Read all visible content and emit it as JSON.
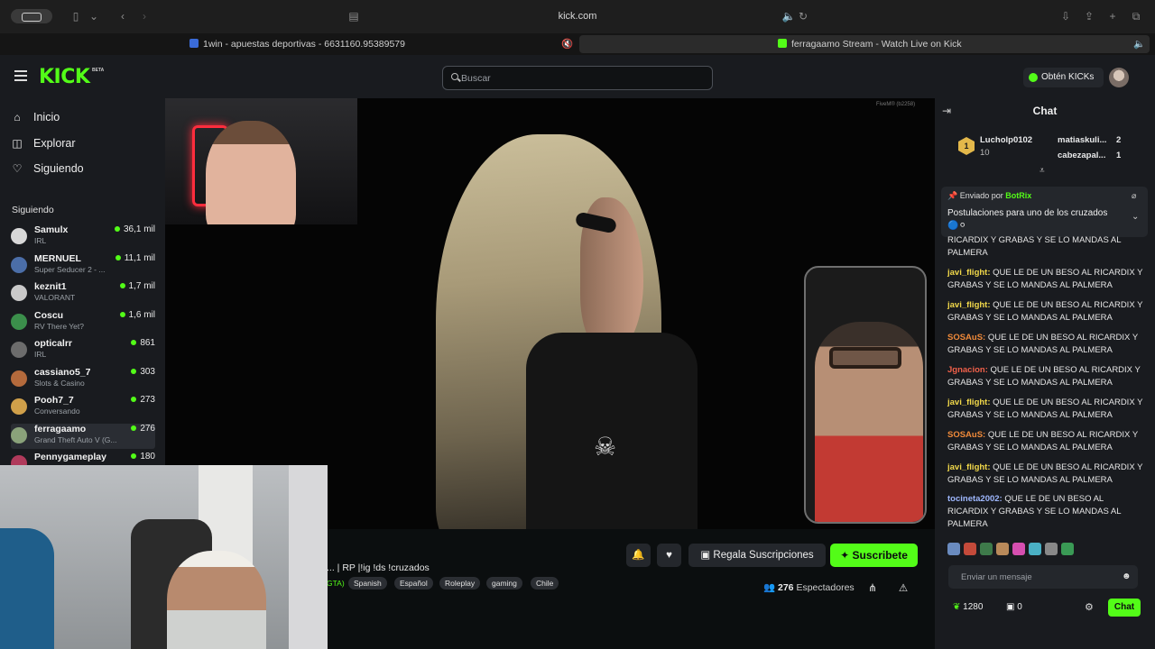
{
  "browser": {
    "url": "kick.com",
    "tabs": [
      {
        "label": "1win - apuestas deportivas - 6631160.95389579"
      },
      {
        "label": "ferragaamo Stream - Watch Live on Kick"
      }
    ]
  },
  "header": {
    "logo": "KICK",
    "beta": "BETA",
    "search_placeholder": "Buscar",
    "kicks_label": "Obtén KICKs"
  },
  "sidebar": {
    "nav": [
      {
        "label": "Inicio",
        "icon": "home-icon"
      },
      {
        "label": "Explorar",
        "icon": "compass-icon"
      },
      {
        "label": "Siguiendo",
        "icon": "heart-icon"
      }
    ],
    "section_title": "Siguiendo",
    "following": [
      {
        "name": "Samulx",
        "category": "IRL",
        "viewers": "36,1 mil",
        "color": "#d8d8d8"
      },
      {
        "name": "MERNUEL",
        "category": "Super Seducer 2 - ...",
        "viewers": "11,1 mil",
        "color": "#4b6ea8"
      },
      {
        "name": "keznit1",
        "category": "VALORANT",
        "viewers": "1,7 mil",
        "color": "#c9c9c9"
      },
      {
        "name": "Coscu",
        "category": "RV There Yet?",
        "viewers": "1,6 mil",
        "color": "#3b8f4b"
      },
      {
        "name": "opticalrr",
        "category": "IRL",
        "viewers": "861",
        "color": "#6c6c6c"
      },
      {
        "name": "cassiano5_7",
        "category": "Slots & Casino",
        "viewers": "303",
        "color": "#b46a3c"
      },
      {
        "name": "Pooh7_7",
        "category": "Conversando",
        "viewers": "273",
        "color": "#d0a04a"
      },
      {
        "name": "ferragaamo",
        "category": "Grand Theft Auto V (G...",
        "viewers": "276",
        "color": "#8aa27a"
      },
      {
        "name": "Pennygameplay",
        "category": "",
        "viewers": "180",
        "color": "#b03a5b"
      }
    ]
  },
  "stream": {
    "title": "... | RP |!ig !ds !cruzados",
    "tag_fragment": "GTA)",
    "tags": [
      "Spanish",
      "Español",
      "Roleplay",
      "gaming",
      "Chile"
    ],
    "gift_label": "Regala Suscripciones",
    "subscribe_label": "Suscribete",
    "viewers_count": "276",
    "viewers_label": "Espectadores",
    "watermark": "FiveM® (b2258)"
  },
  "chat": {
    "title": "Chat",
    "leaderboard": [
      {
        "name": "Lucholp0102",
        "count": "10",
        "color": "#e3b84a"
      },
      {
        "name": "matiaskuli...",
        "count": "2",
        "color": "#e8e8e8"
      },
      {
        "name": "cabezapal...",
        "count": "1",
        "color": "#e3b84a"
      }
    ],
    "pinned_by": "Enviado por",
    "pinned_user": "BotRix",
    "pinned_text": "Postulaciones para uno de los cruzados 🔵⚪",
    "messages": [
      {
        "user": "",
        "text": "RICARDIX Y GRABAS Y SE LO MANDAS AL PALMERA",
        "color": "#e6e6e6"
      },
      {
        "user": "javi_flight:",
        "text": "QUE LE DE UN BESO AL RICARDIX Y GRABAS Y SE LO MANDAS AL PALMERA",
        "color": "#f2d94a"
      },
      {
        "user": "javi_flight:",
        "text": "QUE LE DE UN BESO AL RICARDIX Y GRABAS Y SE LO MANDAS AL PALMERA",
        "color": "#f2d94a"
      },
      {
        "user": "SOSAuS:",
        "text": "QUE LE DE UN BESO AL RICARDIX Y GRABAS Y SE LO MANDAS AL PALMERA",
        "color": "#f08a3a"
      },
      {
        "user": "Jgnacion:",
        "text": "QUE LE DE UN BESO AL RICARDIX Y GRABAS Y SE LO MANDAS AL PALMERA",
        "color": "#f0604a"
      },
      {
        "user": "javi_flight:",
        "text": "QUE LE DE UN BESO AL RICARDIX Y GRABAS Y SE LO MANDAS AL PALMERA",
        "color": "#f2d94a"
      },
      {
        "user": "SOSAuS:",
        "text": "QUE LE DE UN BESO AL RICARDIX Y GRABAS Y SE LO MANDAS AL PALMERA",
        "color": "#f08a3a"
      },
      {
        "user": "javi_flight:",
        "text": "QUE LE DE UN BESO AL RICARDIX Y GRABAS Y SE LO MANDAS AL PALMERA",
        "color": "#f2d94a"
      },
      {
        "user": "tocineta2002:",
        "text": "QUE LE DE UN BESO AL RICARDIX Y GRABAS Y SE LO MANDAS AL PALMERA",
        "color": "#9fb8ff"
      }
    ],
    "input_placeholder": "Enviar un mensaje",
    "points": "1280",
    "gifts": "0",
    "send_label": "Chat"
  },
  "colors": {
    "brand": "#53fc18",
    "bg": "#0b0e0f",
    "panel": "#191b1f"
  }
}
